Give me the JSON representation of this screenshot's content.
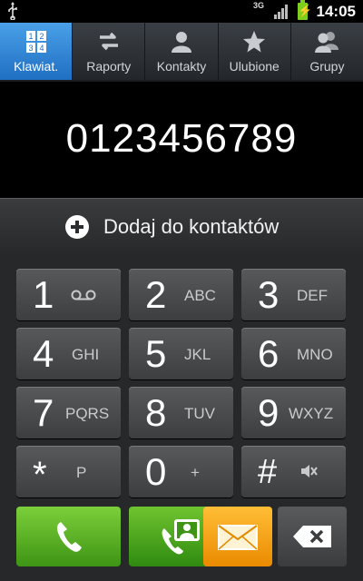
{
  "status": {
    "network": "3G",
    "time": "14:05",
    "battery_icon": "charging-bolt"
  },
  "tabs": [
    {
      "label": "Klawiat.",
      "icon": "dialpad-icon",
      "active": true
    },
    {
      "label": "Raporty",
      "icon": "call-log-icon",
      "active": false
    },
    {
      "label": "Kontakty",
      "icon": "person-icon",
      "active": false
    },
    {
      "label": "Ulubione",
      "icon": "star-icon",
      "active": false
    },
    {
      "label": "Grupy",
      "icon": "group-icon",
      "active": false
    }
  ],
  "display": {
    "number": "0123456789"
  },
  "add_contact": {
    "label": "Dodaj do kontaktów"
  },
  "keys": [
    {
      "digit": "1",
      "letters": ""
    },
    {
      "digit": "2",
      "letters": "ABC"
    },
    {
      "digit": "3",
      "letters": "DEF"
    },
    {
      "digit": "4",
      "letters": "GHI"
    },
    {
      "digit": "5",
      "letters": "JKL"
    },
    {
      "digit": "6",
      "letters": "MNO"
    },
    {
      "digit": "7",
      "letters": "PQRS"
    },
    {
      "digit": "8",
      "letters": "TUV"
    },
    {
      "digit": "9",
      "letters": "WXYZ"
    },
    {
      "digit": "*",
      "letters": "P"
    },
    {
      "digit": "0",
      "letters": "+"
    },
    {
      "digit": "#",
      "letters": ""
    }
  ],
  "colors": {
    "tab_active": "#2e86d8",
    "call_green": "#4caf1f",
    "message_orange": "#f5a312",
    "battery_green": "#7ccf1c"
  }
}
